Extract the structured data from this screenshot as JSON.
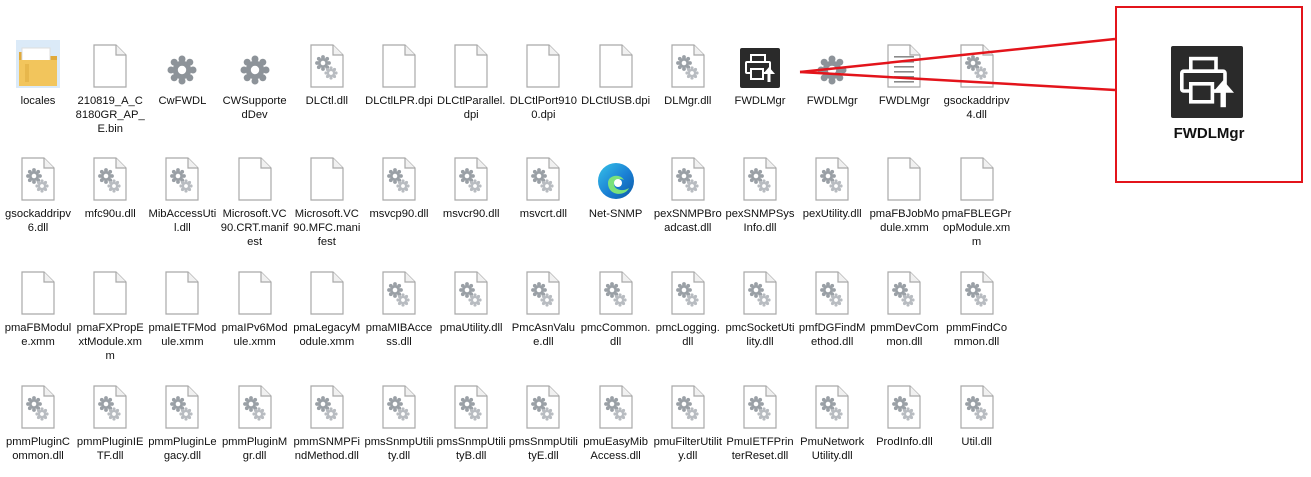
{
  "colors": {
    "callout_border": "#e3141b",
    "folder": "#e8b84a",
    "selected_bg": "#dbeaf8",
    "app_icon_bg": "#2a2a2a"
  },
  "rows": [
    [
      {
        "name": "locales",
        "icon": "folder-icon",
        "selected": true
      },
      {
        "name": "210819_A_C8180GR_AP_E.bin",
        "icon": "blank-file-icon"
      },
      {
        "name": "CwFWDL",
        "icon": "gear-app-icon"
      },
      {
        "name": "CWSupportedDev",
        "icon": "gear-app-icon"
      },
      {
        "name": "DLCtl.dll",
        "icon": "dll-file-icon"
      },
      {
        "name": "DLCtlLPR.dpi",
        "icon": "blank-file-icon"
      },
      {
        "name": "DLCtlParallel.dpi",
        "icon": "blank-file-icon"
      },
      {
        "name": "DLCtlPort9100.dpi",
        "icon": "blank-file-icon"
      },
      {
        "name": "DLCtlUSB.dpi",
        "icon": "blank-file-icon"
      },
      {
        "name": "DLMgr.dll",
        "icon": "dll-file-icon"
      },
      {
        "name": "FWDLMgr",
        "icon": "printer-upload-icon"
      },
      {
        "name": "FWDLMgr",
        "icon": "gear-app-icon"
      },
      {
        "name": "FWDLMgr",
        "icon": "text-file-icon"
      },
      {
        "name": "gsockaddripv4.dll",
        "icon": "dll-file-icon"
      }
    ],
    [
      {
        "name": "gsockaddripv6.dll",
        "icon": "dll-file-icon"
      },
      {
        "name": "mfc90u.dll",
        "icon": "dll-file-icon"
      },
      {
        "name": "MibAccessUtil.dll",
        "icon": "dll-file-icon"
      },
      {
        "name": "Microsoft.VC90.CRT.manifest",
        "icon": "blank-file-icon"
      },
      {
        "name": "Microsoft.VC90.MFC.manifest",
        "icon": "blank-file-icon"
      },
      {
        "name": "msvcp90.dll",
        "icon": "dll-file-icon"
      },
      {
        "name": "msvcr90.dll",
        "icon": "dll-file-icon"
      },
      {
        "name": "msvcrt.dll",
        "icon": "dll-file-icon"
      },
      {
        "name": "Net-SNMP",
        "icon": "edge-browser-icon"
      },
      {
        "name": "pexSNMPBroadcast.dll",
        "icon": "dll-file-icon"
      },
      {
        "name": "pexSNMPSysInfo.dll",
        "icon": "dll-file-icon"
      },
      {
        "name": "pexUtility.dll",
        "icon": "dll-file-icon"
      },
      {
        "name": "pmaFBJobModule.xmm",
        "icon": "blank-file-icon"
      },
      {
        "name": "pmaFBLEGPropModule.xmm",
        "icon": "blank-file-icon"
      }
    ],
    [
      {
        "name": "pmaFBModule.xmm",
        "icon": "blank-file-icon"
      },
      {
        "name": "pmaFXPropExtModule.xmm",
        "icon": "blank-file-icon"
      },
      {
        "name": "pmaIETFModule.xmm",
        "icon": "blank-file-icon"
      },
      {
        "name": "pmaIPv6Module.xmm",
        "icon": "blank-file-icon"
      },
      {
        "name": "pmaLegacyModule.xmm",
        "icon": "blank-file-icon"
      },
      {
        "name": "pmaMIBAccess.dll",
        "icon": "dll-file-icon"
      },
      {
        "name": "pmaUtility.dll",
        "icon": "dll-file-icon"
      },
      {
        "name": "PmcAsnValue.dll",
        "icon": "dll-file-icon"
      },
      {
        "name": "pmcCommon.dll",
        "icon": "dll-file-icon"
      },
      {
        "name": "pmcLogging.dll",
        "icon": "dll-file-icon"
      },
      {
        "name": "pmcSocketUtility.dll",
        "icon": "dll-file-icon"
      },
      {
        "name": "pmfDGFindMethod.dll",
        "icon": "dll-file-icon"
      },
      {
        "name": "pmmDevCommon.dll",
        "icon": "dll-file-icon"
      },
      {
        "name": "pmmFindCommon.dll",
        "icon": "dll-file-icon"
      }
    ],
    [
      {
        "name": "pmmPluginCommon.dll",
        "icon": "dll-file-icon"
      },
      {
        "name": "pmmPluginIETF.dll",
        "icon": "dll-file-icon"
      },
      {
        "name": "pmmPluginLegacy.dll",
        "icon": "dll-file-icon"
      },
      {
        "name": "pmmPluginMgr.dll",
        "icon": "dll-file-icon"
      },
      {
        "name": "pmmSNMPFindMethod.dll",
        "icon": "dll-file-icon"
      },
      {
        "name": "pmsSnmpUtility.dll",
        "icon": "dll-file-icon"
      },
      {
        "name": "pmsSnmpUtilityB.dll",
        "icon": "dll-file-icon"
      },
      {
        "name": "pmsSnmpUtilityE.dll",
        "icon": "dll-file-icon"
      },
      {
        "name": "pmuEasyMibAccess.dll",
        "icon": "dll-file-icon"
      },
      {
        "name": "pmuFilterUtility.dll",
        "icon": "dll-file-icon"
      },
      {
        "name": "PmuIETFPrinterReset.dll",
        "icon": "dll-file-icon"
      },
      {
        "name": "PmuNetworkUtility.dll",
        "icon": "dll-file-icon"
      },
      {
        "name": "ProdInfo.dll",
        "icon": "dll-file-icon"
      },
      {
        "name": "Util.dll",
        "icon": "dll-file-icon"
      }
    ]
  ],
  "callout": {
    "label": "FWDLMgr",
    "icon": "printer-upload-icon"
  }
}
